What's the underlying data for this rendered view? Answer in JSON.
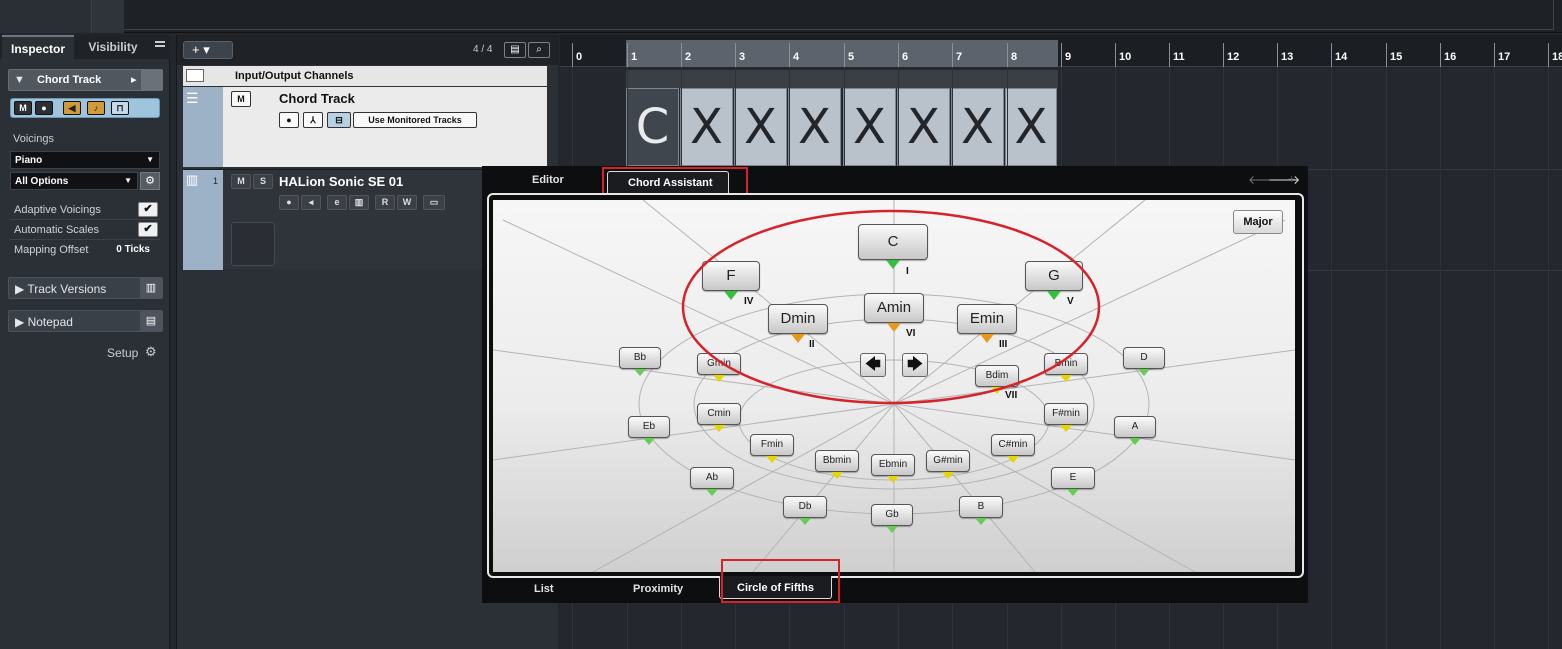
{
  "inspector": {
    "tab_active": "Inspector",
    "tab_other": "Visibility",
    "track_header": "Chord Track",
    "voicings_label": "Voicings",
    "voicing_select": "Piano",
    "options_select": "All Options",
    "adaptive_voicings": "Adaptive Voicings",
    "automatic_scales": "Automatic Scales",
    "mapping_offset": "Mapping Offset",
    "mapping_offset_value": "0 Ticks",
    "track_versions": "Track Versions",
    "notepad": "Notepad",
    "setup": "Setup",
    "btn_m": "M",
    "btn_rec": "●"
  },
  "tracklist": {
    "add": "+ ▾",
    "count": "4 / 4",
    "io_channels": "Input/Output Channels",
    "chord_track_name": "Chord Track",
    "use_monitored": "Use Monitored Tracks",
    "halion_num": "1",
    "halion_name": "HALion Sonic SE 01",
    "btn_m": "M",
    "btn_s": "S",
    "btn_e": "e",
    "btn_r": "R",
    "btn_w": "W"
  },
  "ruler": {
    "ticks": [
      "0",
      "1",
      "2",
      "3",
      "4",
      "5",
      "6",
      "7",
      "8",
      "9",
      "10",
      "11",
      "12",
      "13",
      "14",
      "15",
      "16",
      "17",
      "18"
    ]
  },
  "chord_events": [
    "C",
    "X",
    "X",
    "X",
    "X",
    "X",
    "X",
    "X"
  ],
  "panel": {
    "tab_editor": "Editor",
    "tab_assistant": "Chord Assistant",
    "major": "Major",
    "bottom_list": "List",
    "bottom_proximity": "Proximity",
    "bottom_circle": "Circle of Fifths",
    "arrow_left": "🡄",
    "arrow_right": "🡆"
  },
  "circle": {
    "main": [
      {
        "label": "C",
        "roman": "I",
        "color": "green"
      },
      {
        "label": "F",
        "roman": "IV",
        "color": "green"
      },
      {
        "label": "G",
        "roman": "V",
        "color": "green"
      },
      {
        "label": "Dmin",
        "roman": "II",
        "color": "orange"
      },
      {
        "label": "Amin",
        "roman": "VI",
        "color": "orange"
      },
      {
        "label": "Emin",
        "roman": "III",
        "color": "orange"
      }
    ],
    "small": [
      "Bb",
      "Gmin",
      "Bdim",
      "Bmin",
      "D",
      "Cmin",
      "F#min",
      "Eb",
      "A",
      "Fmin",
      "C#min",
      "Bbmin",
      "Ebmin",
      "G#min",
      "Ab",
      "E",
      "Db",
      "Gb",
      "B"
    ],
    "bdim_roman": "VII"
  },
  "colors": {
    "accent_red": "#d8222a",
    "green": "#34c03a",
    "orange": "#e59a1c",
    "yellow": "#e5d600"
  }
}
